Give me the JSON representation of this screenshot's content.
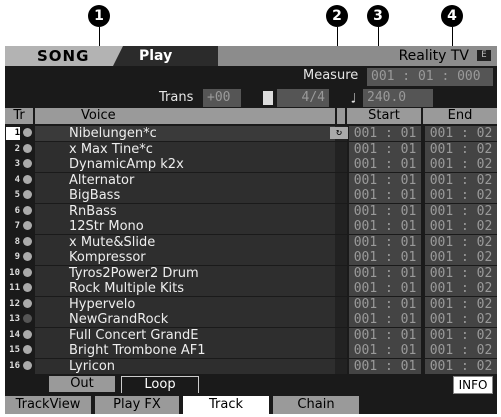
{
  "callouts": [
    "1",
    "2",
    "3",
    "4"
  ],
  "header": {
    "mode": "SONG",
    "page": "Play",
    "song_name": "Reality TV",
    "icon": "E"
  },
  "info": {
    "measure_label": "Measure",
    "measure_value": "001 : 01 : 000",
    "trans_label": "Trans",
    "trans_value": "+00",
    "time_sig": "4/4",
    "tempo": "240.0"
  },
  "columns": {
    "tr": "Tr",
    "voice": "Voice",
    "start": "Start",
    "end": "End"
  },
  "tracks": [
    {
      "num": "1",
      "voice": "Nibelungen*c",
      "start": "001 : 01",
      "end": "001 : 02"
    },
    {
      "num": "2",
      "voice": "x Max Tine*c",
      "start": "001 : 01",
      "end": "001 : 02"
    },
    {
      "num": "3",
      "voice": "DynamicAmp k2x",
      "start": "001 : 01",
      "end": "001 : 02"
    },
    {
      "num": "4",
      "voice": "Alternator",
      "start": "001 : 01",
      "end": "001 : 02"
    },
    {
      "num": "5",
      "voice": "BigBass",
      "start": "001 : 01",
      "end": "001 : 02"
    },
    {
      "num": "6",
      "voice": "RnBass",
      "start": "001 : 01",
      "end": "001 : 02"
    },
    {
      "num": "7",
      "voice": "12Str Mono",
      "start": "001 : 01",
      "end": "001 : 02"
    },
    {
      "num": "8",
      "voice": "x Mute&Slide",
      "start": "001 : 01",
      "end": "001 : 02"
    },
    {
      "num": "9",
      "voice": "Kompressor",
      "start": "001 : 01",
      "end": "001 : 02"
    },
    {
      "num": "10",
      "voice": "Tyros2Power2 Drum",
      "start": "001 : 01",
      "end": "001 : 02"
    },
    {
      "num": "11",
      "voice": "Rock Multiple Kits",
      "start": "001 : 01",
      "end": "001 : 02"
    },
    {
      "num": "12",
      "voice": "Hypervelo",
      "start": "001 : 01",
      "end": "001 : 02"
    },
    {
      "num": "13",
      "voice": "NewGrandRock",
      "start": "001 : 01",
      "end": "001 : 02"
    },
    {
      "num": "14",
      "voice": "Full Concert GrandE",
      "start": "001 : 01",
      "end": "001 : 02"
    },
    {
      "num": "15",
      "voice": "Bright Trombone AF1",
      "start": "001 : 01",
      "end": "001 : 02"
    },
    {
      "num": "16",
      "voice": "Lyricon",
      "start": "001 : 01",
      "end": "001 : 02"
    }
  ],
  "bottom_tabs": [
    "Out",
    "Loop"
  ],
  "info_button": "INFO",
  "function_tabs": [
    "TrackView",
    "Play FX",
    "Track",
    "Chain"
  ]
}
